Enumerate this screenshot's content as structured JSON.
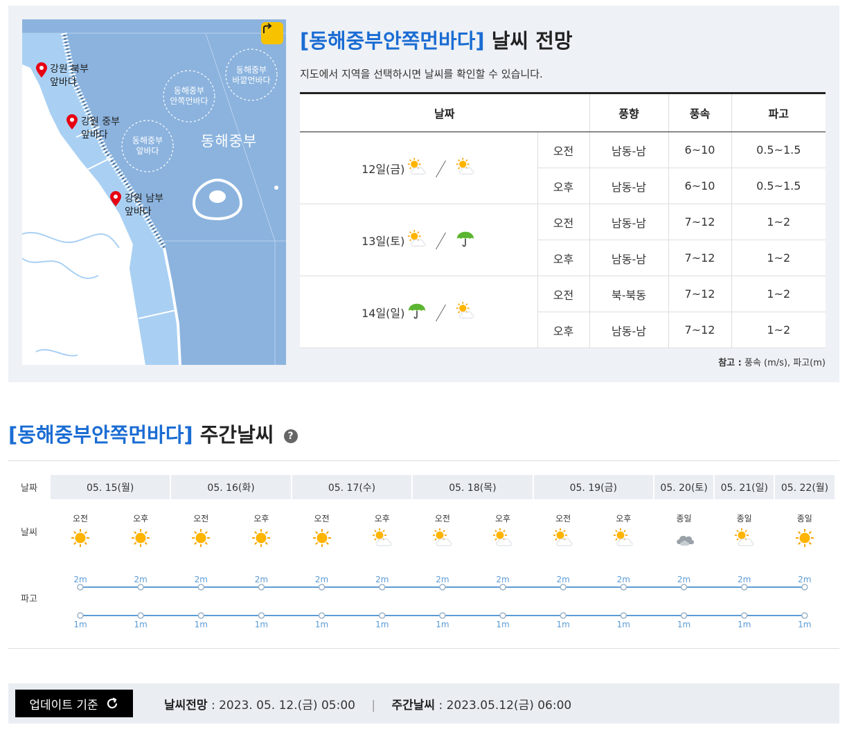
{
  "forecast": {
    "title_region": "[동해중부안쪽먼바다]",
    "title_suffix": "날씨 전망",
    "subtitle": "지도에서 지역을 선택하시면 날씨를 확인할 수 있습니다.",
    "headers": [
      "날짜",
      "풍향",
      "풍속",
      "파고"
    ],
    "days": [
      {
        "date": "12일(금)",
        "icons": [
          "partly-cloudy-icon",
          "partly-cloudy-icon"
        ],
        "rows": [
          {
            "period": "오전",
            "wind_dir": "남동-남",
            "wind_speed": "6~10",
            "wave": "0.5~1.5"
          },
          {
            "period": "오후",
            "wind_dir": "남동-남",
            "wind_speed": "6~10",
            "wave": "0.5~1.5"
          }
        ]
      },
      {
        "date": "13일(토)",
        "icons": [
          "partly-cloudy-icon",
          "umbrella-icon"
        ],
        "rows": [
          {
            "period": "오전",
            "wind_dir": "남동-남",
            "wind_speed": "7~12",
            "wave": "1~2"
          },
          {
            "period": "오후",
            "wind_dir": "남동-남",
            "wind_speed": "7~12",
            "wave": "1~2"
          }
        ]
      },
      {
        "date": "14일(일)",
        "icons": [
          "umbrella-icon",
          "partly-cloudy-icon"
        ],
        "rows": [
          {
            "period": "오전",
            "wind_dir": "북-북동",
            "wind_speed": "7~12",
            "wave": "1~2"
          },
          {
            "period": "오후",
            "wind_dir": "남동-남",
            "wind_speed": "7~12",
            "wave": "1~2"
          }
        ]
      }
    ],
    "note_label": "참고 :",
    "note_text": "풍속 (m/s), 파고(m)"
  },
  "map": {
    "markers": [
      {
        "line1": "강원 북부",
        "line2": "앞바다"
      },
      {
        "line1": "강원 중부",
        "line2": "앞바다"
      },
      {
        "line1": "강원 남부",
        "line2": "앞바다"
      }
    ],
    "zones": [
      {
        "line1": "동해중부",
        "line2": "바깥먼바다"
      },
      {
        "line1": "동해중부",
        "line2": "안쪽먼바다"
      },
      {
        "line1": "동해중부",
        "line2": "앞바다"
      }
    ],
    "sea_name": "동해중부",
    "share_icon": "share-icon"
  },
  "weekly": {
    "title_region": "[동해중부안쪽먼바다]",
    "title_suffix": "주간날씨",
    "row_labels": {
      "date": "날짜",
      "weather": "날씨",
      "wave": "파고"
    },
    "days": [
      {
        "date": "05. 15(월)",
        "slots": [
          {
            "label": "오전",
            "icon": "sunny-icon",
            "wave_high": "2m",
            "wave_low": "1m"
          },
          {
            "label": "오후",
            "icon": "sunny-icon",
            "wave_high": "2m",
            "wave_low": "1m"
          }
        ]
      },
      {
        "date": "05. 16(화)",
        "slots": [
          {
            "label": "오전",
            "icon": "sunny-icon",
            "wave_high": "2m",
            "wave_low": "1m"
          },
          {
            "label": "오후",
            "icon": "sunny-icon",
            "wave_high": "2m",
            "wave_low": "1m"
          }
        ]
      },
      {
        "date": "05. 17(수)",
        "slots": [
          {
            "label": "오전",
            "icon": "sunny-icon",
            "wave_high": "2m",
            "wave_low": "1m"
          },
          {
            "label": "오후",
            "icon": "partly-cloudy-icon",
            "wave_high": "2m",
            "wave_low": "1m"
          }
        ]
      },
      {
        "date": "05. 18(목)",
        "slots": [
          {
            "label": "오전",
            "icon": "partly-cloudy-icon",
            "wave_high": "2m",
            "wave_low": "1m"
          },
          {
            "label": "오후",
            "icon": "partly-cloudy-icon",
            "wave_high": "2m",
            "wave_low": "1m"
          }
        ]
      },
      {
        "date": "05. 19(금)",
        "slots": [
          {
            "label": "오전",
            "icon": "partly-cloudy-icon",
            "wave_high": "2m",
            "wave_low": "1m"
          },
          {
            "label": "오후",
            "icon": "partly-cloudy-icon",
            "wave_high": "2m",
            "wave_low": "1m"
          }
        ]
      },
      {
        "date": "05. 20(토)",
        "slots": [
          {
            "label": "종일",
            "icon": "cloudy-icon",
            "wave_high": "2m",
            "wave_low": "1m"
          }
        ]
      },
      {
        "date": "05. 21(일)",
        "slots": [
          {
            "label": "종일",
            "icon": "partly-cloudy-icon",
            "wave_high": "2m",
            "wave_low": "1m"
          }
        ]
      },
      {
        "date": "05. 22(월)",
        "slots": [
          {
            "label": "종일",
            "icon": "sunny-icon",
            "wave_high": "2m",
            "wave_low": "1m"
          }
        ]
      }
    ]
  },
  "footer": {
    "button_label": "업데이트 기준",
    "button_icon": "refresh-icon",
    "forecast_label": "날씨전망",
    "forecast_value": ": 2023. 05. 12.(금) 05:00",
    "weekly_label": "주간날씨",
    "weekly_value": ": 2023.05.12(금) 06:00",
    "separator": "|"
  },
  "colors": {
    "accent": "#1a6cd3",
    "sea": "#8bb3de",
    "coast": "#a9d0f3",
    "land": "#ffffff",
    "marker": "#e60012",
    "wave_line": "#5b9bd5",
    "share_button": "#f7c300"
  }
}
